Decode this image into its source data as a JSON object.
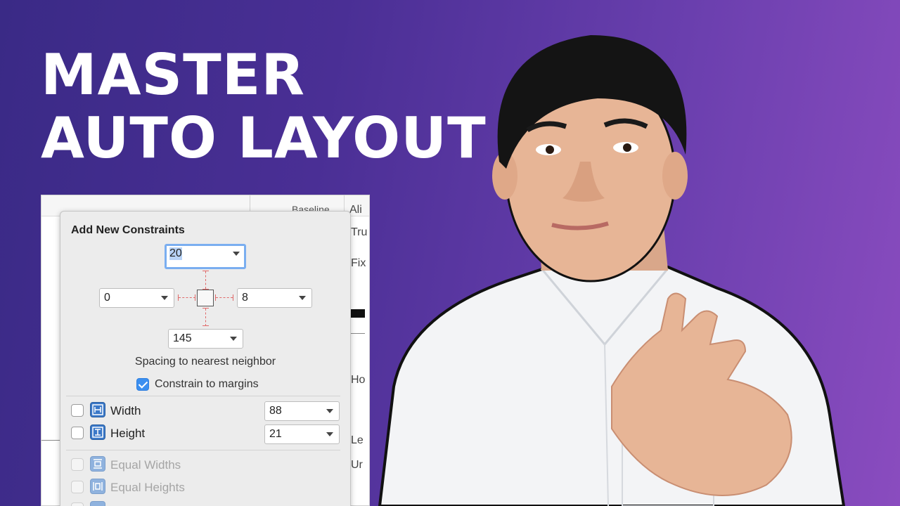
{
  "headline": {
    "line1": "MASTER",
    "line2": "AUTO LAYOUT"
  },
  "inspector": {
    "baseline_label": "Baseline",
    "side_labels": [
      "Ali",
      "Tru",
      "Fix",
      "Ho",
      "Le",
      "Ur"
    ]
  },
  "popover": {
    "title": "Add New Constraints",
    "top_value": "20",
    "left_value": "0",
    "right_value": "8",
    "bottom_value": "145",
    "spacing_caption": "Spacing to nearest neighbor",
    "constrain_margins_label": "Constrain to margins",
    "constrain_margins_checked": true,
    "width": {
      "label": "Width",
      "value": "88",
      "checked": false
    },
    "height": {
      "label": "Height",
      "value": "21",
      "checked": false
    },
    "equal_widths_label": "Equal Widths",
    "equal_heights_label": "Equal Heights",
    "icons": {
      "width": "width-constraint-icon",
      "height": "height-constraint-icon",
      "equal_widths": "equal-widths-icon",
      "equal_heights": "equal-heights-icon"
    }
  },
  "colors": {
    "accent_blue": "#3b8ff0",
    "focus_ring": "#7aaef0",
    "constraint_red": "#e06a6a"
  }
}
